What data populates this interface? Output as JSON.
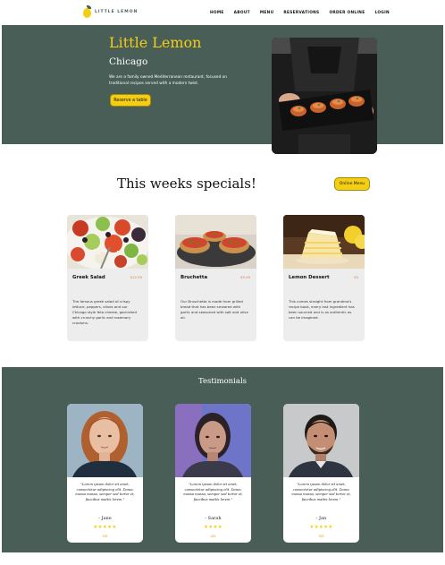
{
  "nav": {
    "logo_text": "LITTLE LEMON",
    "links": [
      "HOME",
      "ABOUT",
      "MENU",
      "RESERVATIONS",
      "ORDER ONLINE",
      "LOGIN"
    ]
  },
  "hero": {
    "title": "Little Lemon",
    "subtitle": "Chicago",
    "description": "We are a family owned Mediterranean restaurant, focused on traditional recipes served with a modern twist.",
    "button_label": "Reserve a table"
  },
  "specials": {
    "title": "This weeks specials!",
    "button_label": "Online Menu",
    "items": [
      {
        "name": "Greek Salad",
        "price": "$12.99",
        "description": "The famous greek salad of crispy lettuce, peppers, olives and our Chicago style feta cheese, garnished with crunchy garlic and rosemary croutons."
      },
      {
        "name": "Bruchetta",
        "price": "$5.99",
        "description": "Our Bruschetta is made from grilled bread that has been smeared with garlic and seasoned with salt and olive oil."
      },
      {
        "name": "Lemon Dessert",
        "price": "$5",
        "description": "This comes straight from grandma's recipe book, every last ingredient has been sourced and is as authentic as can be imagined."
      }
    ]
  },
  "testimonials": {
    "title": "Testimonials",
    "items": [
      {
        "quote": "\"Lorem ipsum dolor sit amet, consectetur adipiscing elit. Donec massa massa, semper sed tortor et, faucibus mattis lorem.\"",
        "name": "- Jane",
        "stars": "★★★★★",
        "rating": "5/5"
      },
      {
        "quote": "\"Lorem ipsum dolor sit amet, consectetur adipiscing elit. Donec massa massa, semper sed tortor et, faucibus mattis lorem.\"",
        "name": "- Sarah",
        "stars": "★★★★",
        "rating": "4/5"
      },
      {
        "quote": "\"Lorem ipsum dolor sit amet, consectetur adipiscing elit. Donec massa massa, semper sed tortor et, faucibus mattis lorem.\"",
        "name": "- Jan",
        "stars": "★★★★★",
        "rating": "5/5"
      }
    ]
  },
  "colors": {
    "primary_green": "#495e57",
    "primary_yellow": "#f4ce14",
    "card_gray": "#ededed",
    "price_orange": "#e07b53"
  }
}
